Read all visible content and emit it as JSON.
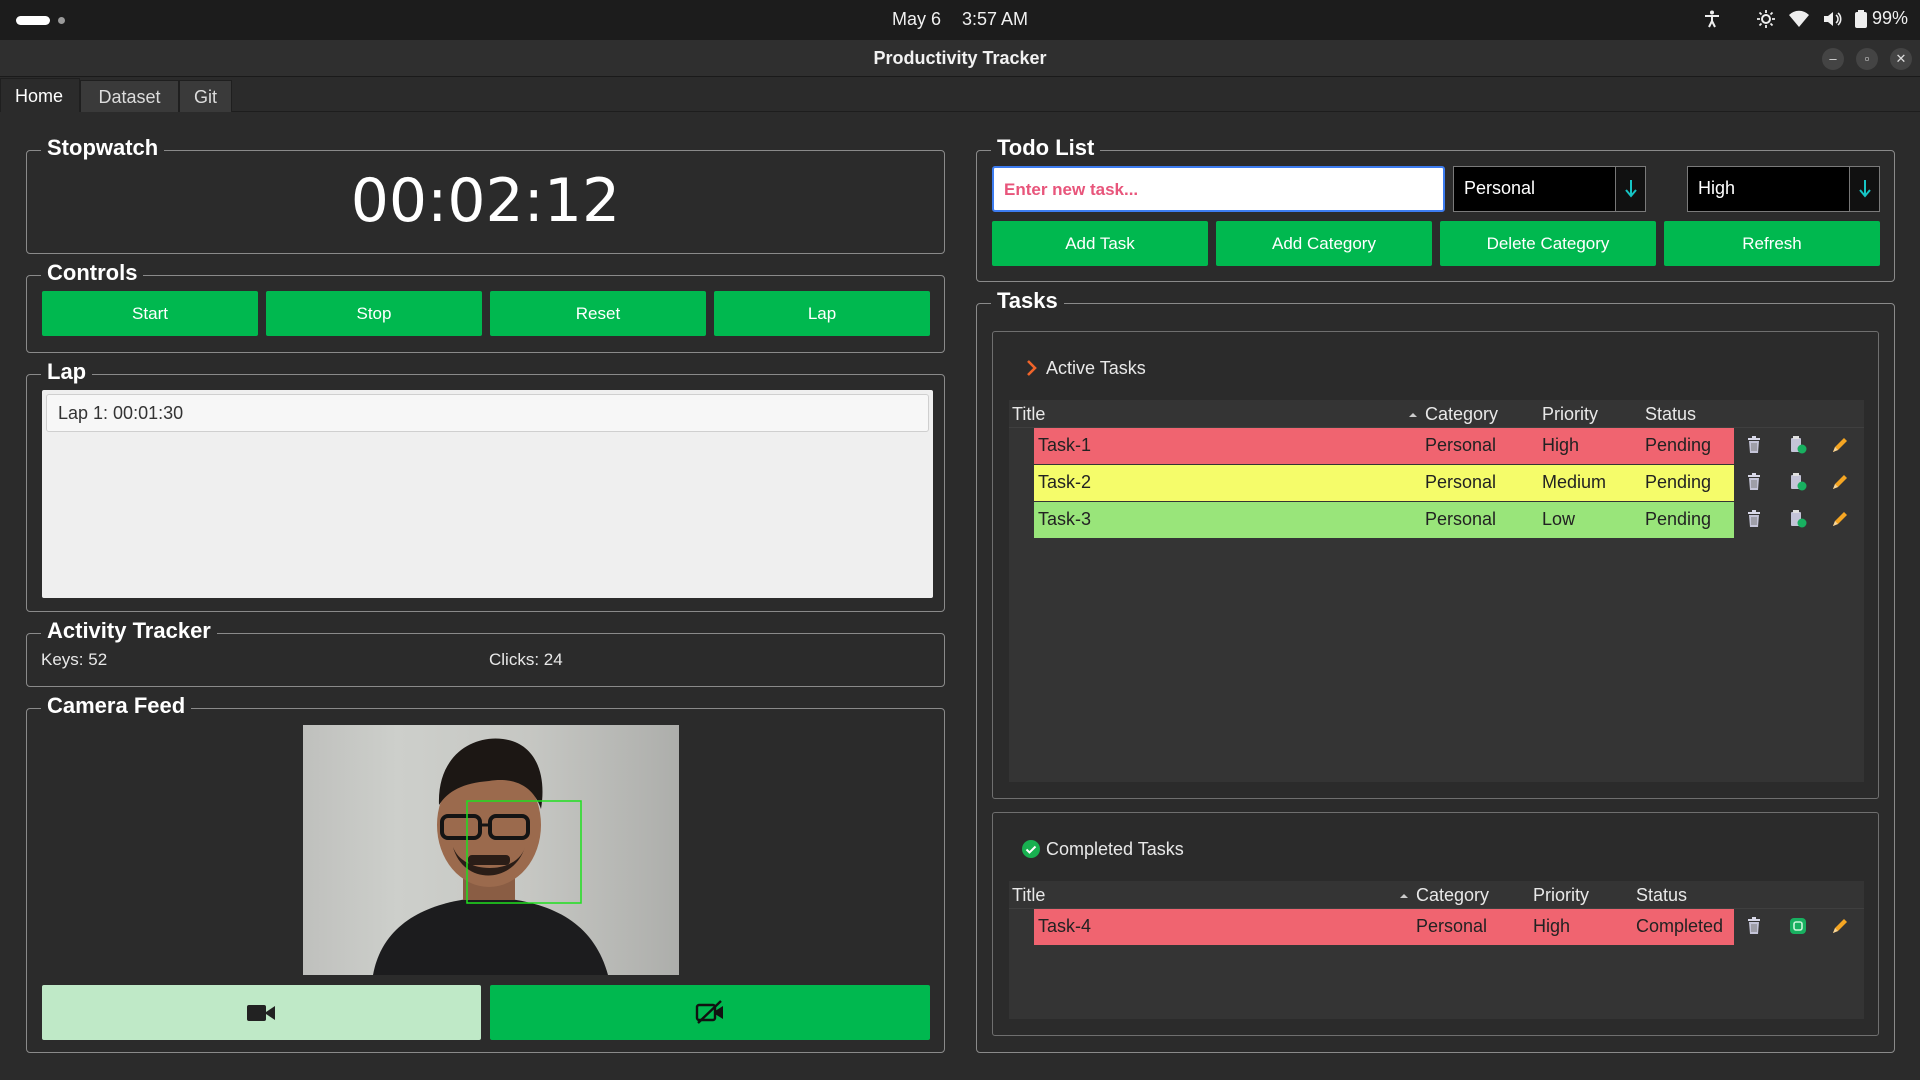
{
  "system_bar": {
    "date": "May 6",
    "time": "3:57 AM",
    "battery": "99%"
  },
  "window": {
    "title": "Productivity Tracker"
  },
  "tabs": [
    {
      "label": "Home"
    },
    {
      "label": "Dataset"
    },
    {
      "label": "Git"
    }
  ],
  "stopwatch": {
    "title": "Stopwatch",
    "time": "00:02:12"
  },
  "controls": {
    "title": "Controls",
    "start": "Start",
    "stop": "Stop",
    "reset": "Reset",
    "lap": "Lap"
  },
  "lap": {
    "title": "Lap",
    "items": [
      "Lap 1: 00:01:30"
    ]
  },
  "activity": {
    "title": "Activity Tracker",
    "keys": "Keys: 52",
    "clicks": "Clicks: 24"
  },
  "camera": {
    "title": "Camera Feed",
    "start_icon": "video-camera-icon",
    "stop_icon": "video-camera-off-icon"
  },
  "todo": {
    "title": "Todo List",
    "task_placeholder": "Enter new task...",
    "category": "Personal",
    "priority": "High",
    "add_task": "Add Task",
    "add_category": "Add Category",
    "delete_category": "Delete Category",
    "refresh": "Refresh"
  },
  "tasks": {
    "title": "Tasks",
    "active": {
      "label": "Active Tasks",
      "columns": [
        "Title",
        "Category",
        "Priority",
        "Status"
      ],
      "rows": [
        {
          "title": "Task-1",
          "category": "Personal",
          "priority": "High",
          "status": "Pending",
          "color": "#f06470"
        },
        {
          "title": "Task-2",
          "category": "Personal",
          "priority": "Medium",
          "status": "Pending",
          "color": "#f5fc6a"
        },
        {
          "title": "Task-3",
          "category": "Personal",
          "priority": "Low",
          "status": "Pending",
          "color": "#99e57a"
        }
      ]
    },
    "completed": {
      "label": "Completed Tasks",
      "columns": [
        "Title",
        "Category",
        "Priority",
        "Status"
      ],
      "rows": [
        {
          "title": "Task-4",
          "category": "Personal",
          "priority": "High",
          "status": "Completed",
          "color": "#f06470"
        }
      ]
    }
  },
  "colors": {
    "accent": "#00b84f",
    "camera_light": "#bfe9c7",
    "face_box": "#1fe01f"
  }
}
